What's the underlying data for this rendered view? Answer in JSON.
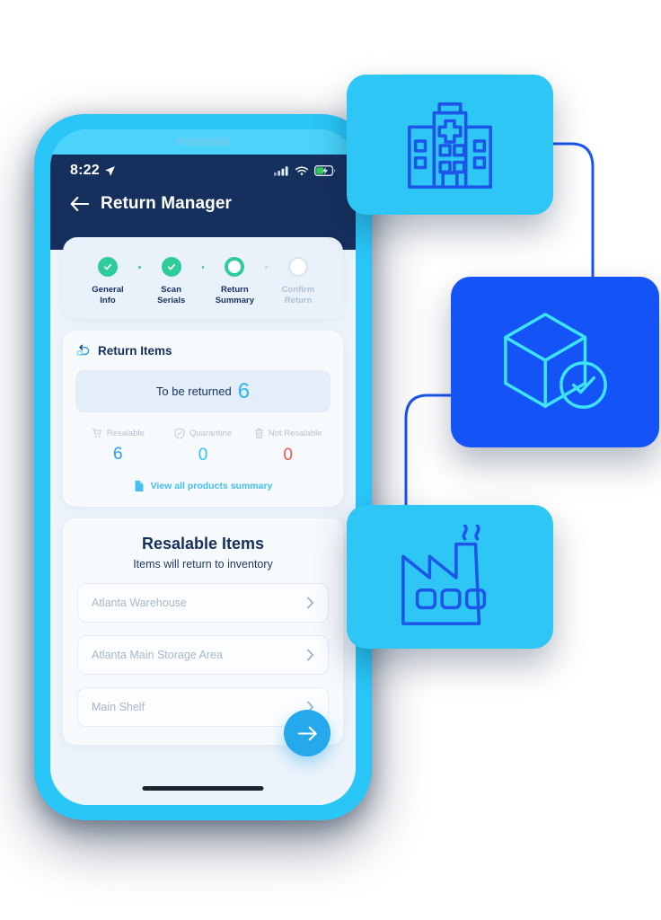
{
  "phone": {
    "status_bar": {
      "time": "8:22",
      "location_icon": "location-arrow-icon",
      "signal_icon": "cellular-signal-icon",
      "wifi_icon": "wifi-icon",
      "battery_icon": "battery-charging-icon"
    },
    "nav": {
      "back_icon": "back-arrow-icon",
      "title": "Return Manager"
    },
    "stepper": {
      "steps": [
        {
          "label_line1": "General",
          "label_line2": "Info",
          "state": "done"
        },
        {
          "label_line1": "Scan",
          "label_line2": "Serials",
          "state": "done"
        },
        {
          "label_line1": "Return",
          "label_line2": "Summary",
          "state": "active"
        },
        {
          "label_line1": "Confirm",
          "label_line2": "Return",
          "state": "todo"
        }
      ]
    },
    "return_items": {
      "icon": "return-arrow-icon",
      "title": "Return Items",
      "to_be_returned_label": "To be returned",
      "to_be_returned_count": "6",
      "stats": [
        {
          "icon": "shopping-cart-icon",
          "label": "Resalable",
          "value": "6",
          "color_class": "v-blue"
        },
        {
          "icon": "shield-icon",
          "label": "Quarantine",
          "value": "0",
          "color_class": "v-cyan"
        },
        {
          "icon": "trash-icon",
          "label": "Not Resalable",
          "value": "0",
          "color_class": "v-red"
        }
      ],
      "view_all_icon": "document-icon",
      "view_all_label": "View all products summary"
    },
    "resalable": {
      "title": "Resalable Items",
      "subtitle": "Items will return to inventory",
      "rows": [
        {
          "label": "Atlanta Warehouse",
          "chevron": "chevron-right-icon"
        },
        {
          "label": "Atlanta Main Storage Area",
          "chevron": "chevron-right-icon"
        },
        {
          "label": "Main Shelf",
          "chevron": "chevron-right-icon"
        }
      ]
    },
    "fab_icon": "arrow-right-icon",
    "home_indicator": "home-indicator"
  },
  "floating_cards": [
    {
      "id": "card-hospital",
      "icon": "hospital-building-icon",
      "bg": "#2DC6F5",
      "stroke": "#1C55E8"
    },
    {
      "id": "card-box",
      "icon": "package-box-check-icon",
      "bg": "#1453F5",
      "stroke": "#3EE3FB"
    },
    {
      "id": "card-factory",
      "icon": "factory-icon",
      "bg": "#2DC6F5",
      "stroke": "#1C55E8"
    }
  ],
  "colors": {
    "phone_bezel": "#29C6F7",
    "header_navy": "#16305E",
    "screen_bg": "#EDF3FA",
    "accent_green": "#2FCC9B",
    "accent_blue": "#26A9EC",
    "card_cyan": "#2DC6F5",
    "card_blue": "#1453F5",
    "connector_line": "#1A56EC"
  }
}
